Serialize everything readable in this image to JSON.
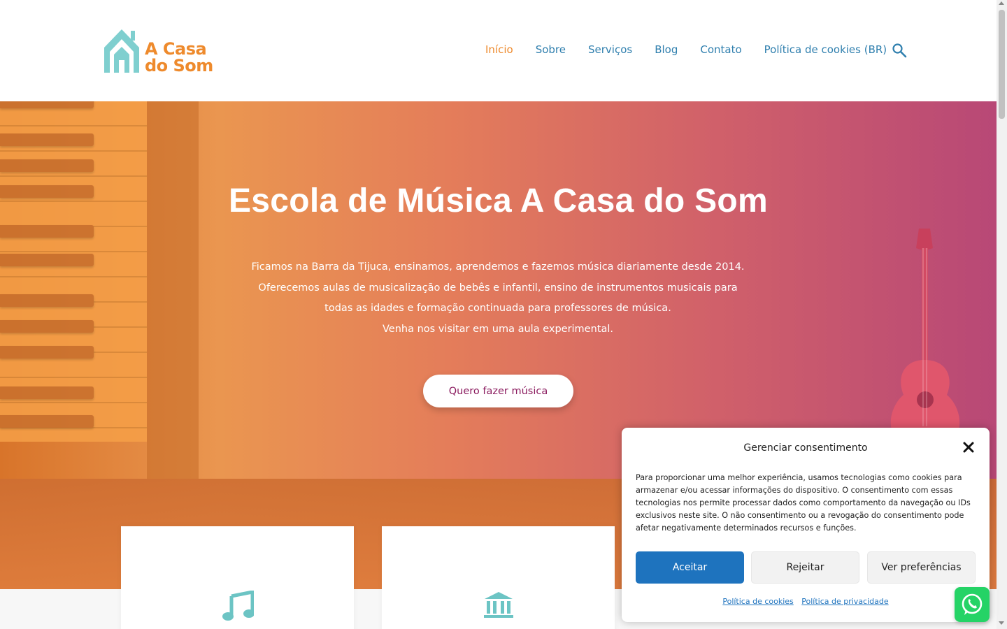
{
  "header": {
    "logo": {
      "line1": "A Casa",
      "line2": "do Som",
      "icon": "house-logo-icon"
    },
    "nav": [
      {
        "label": "Início",
        "active": true
      },
      {
        "label": "Sobre"
      },
      {
        "label": "Serviços"
      },
      {
        "label": "Blog"
      },
      {
        "label": "Contato"
      },
      {
        "label": "Política de cookies (BR)"
      }
    ],
    "search_icon": "search-icon"
  },
  "hero": {
    "title": "Escola de Música A Casa do Som",
    "lines": [
      "Ficamos na Barra da Tijuca, ensinamos, aprendemos e fazemos música diariamente desde 2014.",
      "Oferecemos aulas de musicalização de bebês e infantil, ensino de instrumentos musicais para todas as idades e formação continuada para professores de música.",
      "Venha nos visitar em uma aula experimental."
    ],
    "cta": "Quero fazer música"
  },
  "cards": [
    {
      "icon": "music-note-icon"
    },
    {
      "icon": "institution-icon"
    }
  ],
  "cookie": {
    "title": "Gerenciar consentimento",
    "text": "Para proporcionar uma melhor experiência, usamos tecnologias como cookies para armazenar e/ou acessar informações do dispositivo. O consentimento com essas tecnologias nos permite processar dados como comportamento da navegação ou IDs exclusivos neste site. O não consentimento ou a revogação do consentimento pode afetar negativamente determinados recursos e funções.",
    "accept": "Aceitar",
    "reject": "Rejeitar",
    "preferences": "Ver preferências",
    "link_cookies": "Política de cookies",
    "link_privacy": "Política de privacidade"
  },
  "colors": {
    "accent": "#ee8a2c",
    "nav": "#2f7fae",
    "teal": "#7fcfcf",
    "button_blue": "#1e73be",
    "cta_text": "#8a1a5e",
    "whatsapp": "#25d366"
  }
}
